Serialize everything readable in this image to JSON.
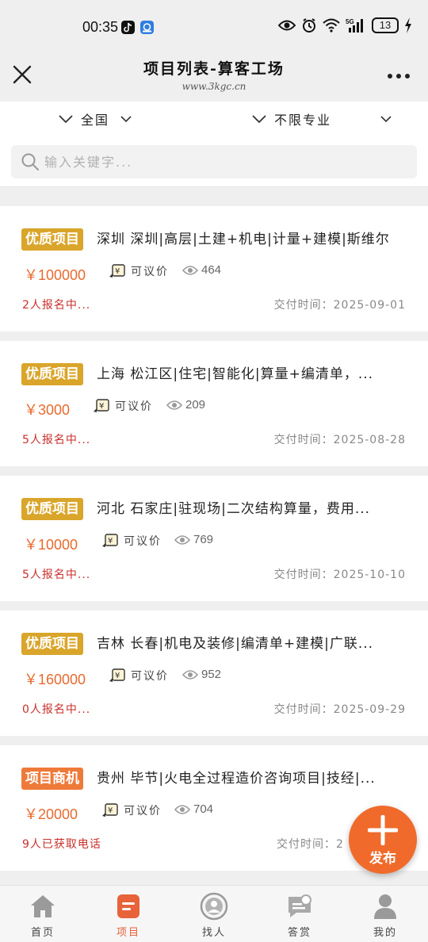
{
  "status_bar": {
    "time": "00:35",
    "battery": "13",
    "icons": [
      "tiktok-icon",
      "app-notification-icon",
      "eye-icon",
      "alarm-icon",
      "wifi-icon",
      "signal-5g-icon",
      "charging-icon"
    ]
  },
  "header": {
    "title": "项目列表-算客工场",
    "subtitle": "www.3kgc.cn"
  },
  "filters": {
    "region": "全国",
    "specialty": "不限专业"
  },
  "search": {
    "placeholder": "输入关键字..."
  },
  "projects": [
    {
      "tag": "优质项目",
      "tag_color": "#d9a52a",
      "title": "深圳 深圳|高层|土建+机电|计量+建模|斯维尔",
      "price": "￥100000",
      "negotiable": "可议价",
      "views": "464",
      "signup": "2人报名中...",
      "delivery": "交付时间：2025-09-01"
    },
    {
      "tag": "优质项目",
      "tag_color": "#d9a52a",
      "title": "上海 松江区|住宅|智能化|算量+编清单，...",
      "price": "￥3000",
      "negotiable": "可议价",
      "views": "209",
      "signup": "5人报名中...",
      "delivery": "交付时间：2025-08-28"
    },
    {
      "tag": "优质项目",
      "tag_color": "#d9a52a",
      "title": "河北 石家庄|驻现场|二次结构算量，费用...",
      "price": "￥10000",
      "negotiable": "可议价",
      "views": "769",
      "signup": "5人报名中...",
      "delivery": "交付时间：2025-10-10"
    },
    {
      "tag": "优质项目",
      "tag_color": "#d9a52a",
      "title": "吉林 长春|机电及装修|编清单+建模|广联...",
      "price": "￥160000",
      "negotiable": "可议价",
      "views": "952",
      "signup": "0人报名中...",
      "delivery": "交付时间：2025-09-29"
    },
    {
      "tag": "项目商机",
      "tag_color": "#ee7a3a",
      "title": "贵州 毕节|火电全过程造价咨询项目|技经|...",
      "price": "￥20000",
      "negotiable": "可议价",
      "views": "704",
      "signup": "9人已获取电话",
      "delivery": "交付时间：2"
    }
  ],
  "fab": {
    "label": "发布"
  },
  "bottom_nav": [
    {
      "label": "首页",
      "icon": "home-icon",
      "active": false
    },
    {
      "label": "项目",
      "icon": "project-icon",
      "active": true
    },
    {
      "label": "找人",
      "icon": "find-people-icon",
      "active": false
    },
    {
      "label": "答赏",
      "icon": "answer-reward-icon",
      "active": false
    },
    {
      "label": "我的",
      "icon": "profile-icon",
      "active": false
    }
  ],
  "colors": {
    "accent": "#e8623a",
    "price": "#e86a2d",
    "signup_red": "#c9302c"
  }
}
